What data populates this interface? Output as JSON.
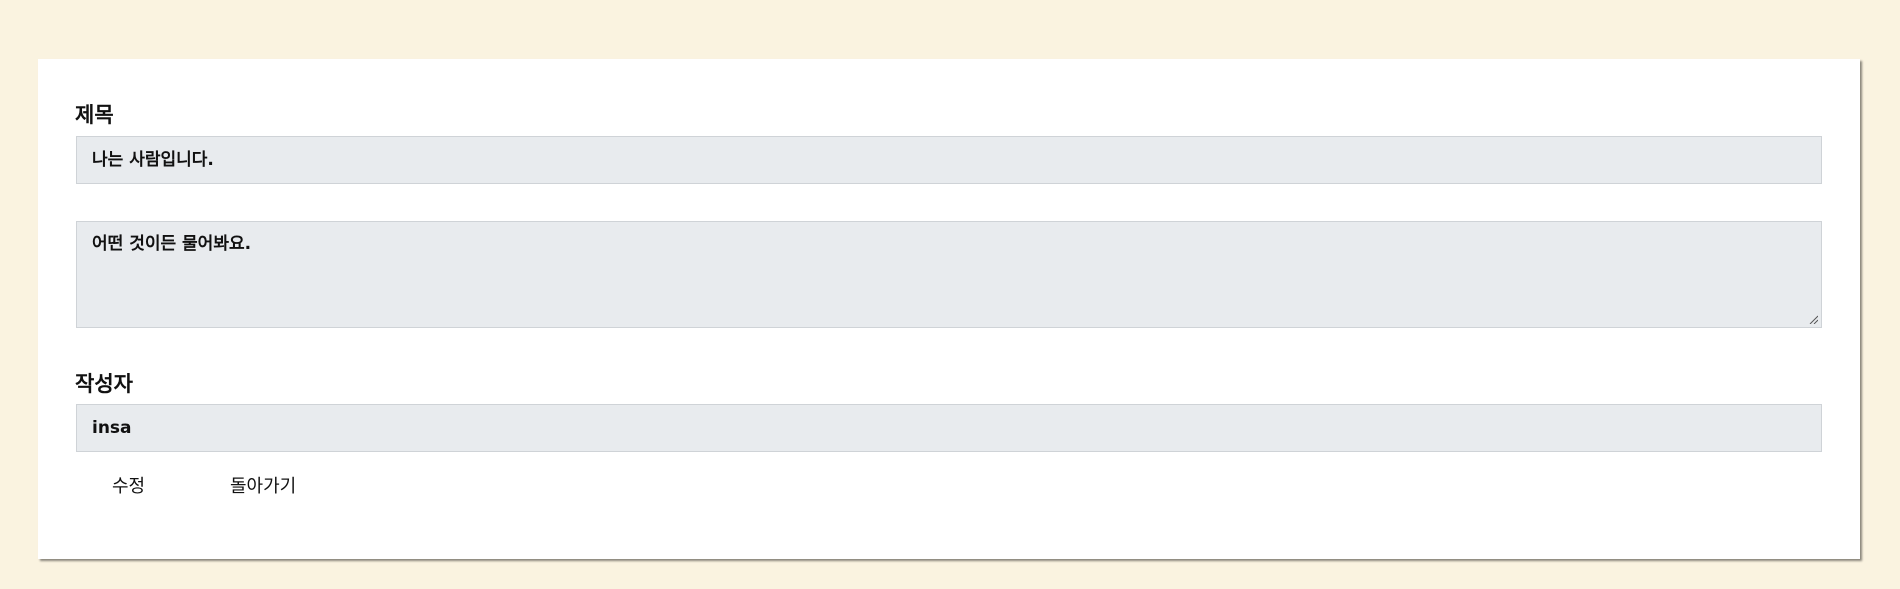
{
  "form": {
    "title_label": "제목",
    "title_value": "나는 사람입니다.",
    "content_value": "어떤 것이든 물어봐요.",
    "author_label": "작성자",
    "author_value": "insa"
  },
  "actions": {
    "edit_label": "수정",
    "back_label": "돌아가기"
  },
  "colors": {
    "page_background": "#faf3e0",
    "card_background": "#ffffff",
    "field_background": "#e8ebee"
  }
}
